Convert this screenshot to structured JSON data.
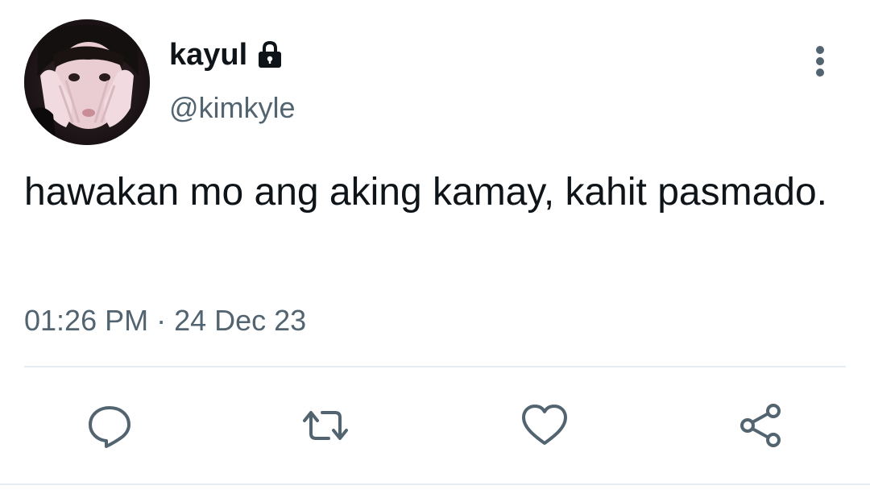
{
  "tweet": {
    "display_name": "kayul",
    "handle": "@kimkyle",
    "text": "hawakan mo ang aking kamay, kahit pasmado.",
    "time": "01:26 PM",
    "separator": "·",
    "date": "24 Dec 23"
  },
  "icons": {
    "lock": "lock-icon",
    "menu": "more-vertical-icon",
    "reply": "reply-icon",
    "retweet": "retweet-icon",
    "like": "heart-icon",
    "share": "share-icon"
  },
  "colors": {
    "text_primary": "#0f1419",
    "text_secondary": "#536471",
    "divider": "#e6ecf0"
  }
}
